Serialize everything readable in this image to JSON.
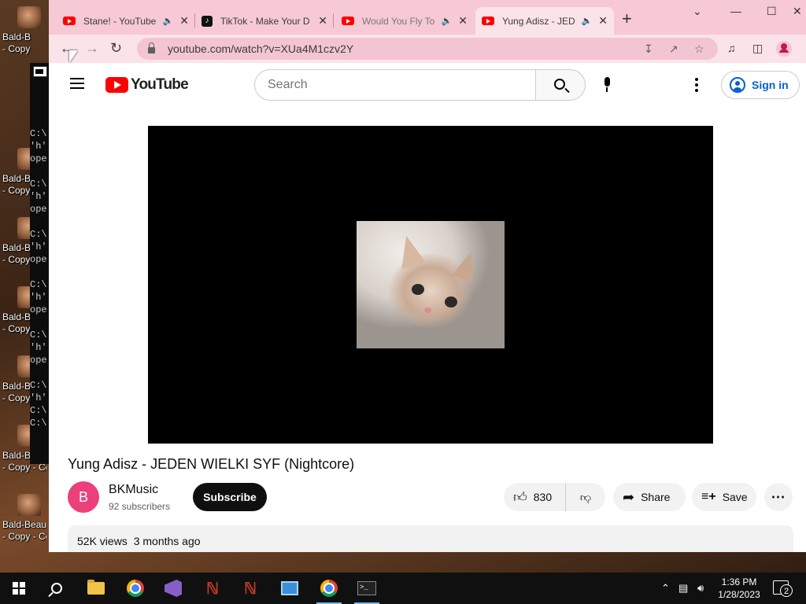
{
  "desktop": {
    "icons": [
      {
        "label": "Bald-B\n- Copy"
      },
      {
        "label": "Bald-B\n- Copy"
      },
      {
        "label": "Bald-B\n- Copy"
      },
      {
        "label": "Bald-B\n- Copy"
      },
      {
        "label": "Bald-B\n- Copy"
      },
      {
        "label": "Bald-B\n- Copy - Co"
      },
      {
        "label": "Bald-Beaut\n- Copy - Co"
      }
    ],
    "console_lines": "C:\\\n'h'\nope\n\nC:\\\n'h'\nope\n\nC:\\\n'h'\nope\n\nC:\\\n'h'\nope\n\nC:\\\n'h'\nope\n\nC:\\\n'h'\nC:\\\nC:\\"
  },
  "browser": {
    "tabs": [
      {
        "title": "Stane! - YouTube",
        "favicon": "youtube-icon",
        "audio": true
      },
      {
        "title": "TikTok - Make Your D",
        "favicon": "tiktok-icon",
        "audio": false
      },
      {
        "title": "Would You Fly To",
        "favicon": "youtube-icon",
        "audio": true
      },
      {
        "title": "Yung Adisz - JED",
        "favicon": "youtube-icon",
        "audio": true
      }
    ],
    "new_tab": "+",
    "url": "youtube.com/watch?v=XUa4M1czv2Y",
    "accent": "#f7c8d6"
  },
  "youtube": {
    "logo_text": "YouTube",
    "search_placeholder": "Search",
    "sign_in": "Sign in",
    "video": {
      "title": "Yung Adisz - JEDEN WIELKI SYF (Nightcore)",
      "channel": "BKMusic",
      "channel_initial": "B",
      "subscribers": "92 subscribers",
      "subscribe": "Subscribe",
      "likes": "830",
      "share": "Share",
      "save": "Save",
      "views": "52K views",
      "age": "3 months ago"
    }
  },
  "taskbar": {
    "time": "1:36 PM",
    "date": "1/28/2023",
    "notification_count": "2"
  }
}
